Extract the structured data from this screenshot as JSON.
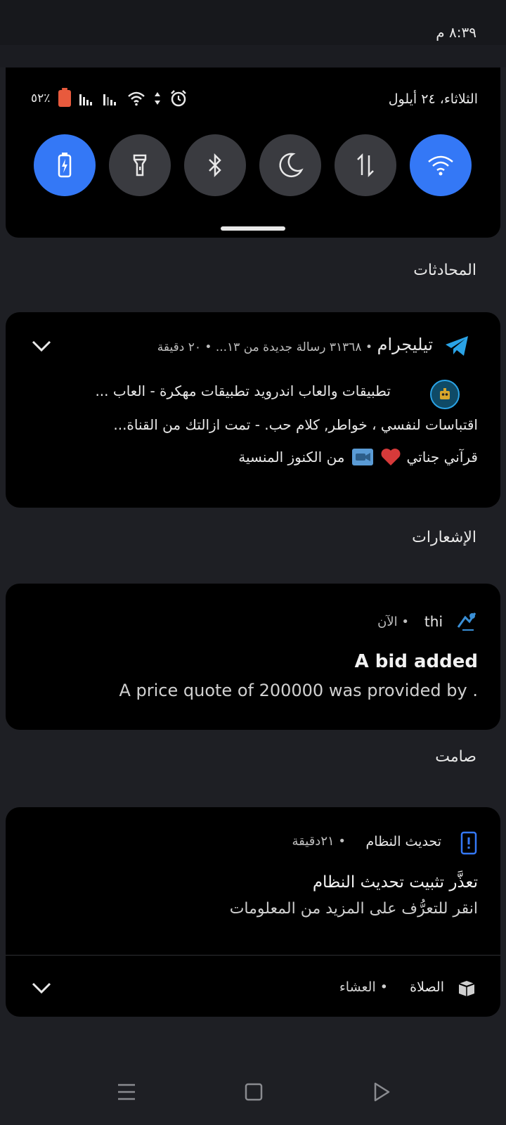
{
  "status_bar": {
    "time": "٨:٣٩ م"
  },
  "quick_settings": {
    "date": "الثلاثاء، ٢٤ أيلول",
    "battery_percent": "٥٢٪",
    "tiles": [
      {
        "icon": "wifi-icon",
        "active": true
      },
      {
        "icon": "data-transfer-icon",
        "active": false
      },
      {
        "icon": "moon-icon",
        "active": false
      },
      {
        "icon": "bluetooth-icon",
        "active": false
      },
      {
        "icon": "flashlight-icon",
        "active": false
      },
      {
        "icon": "battery-saver-icon",
        "active": true
      }
    ],
    "active_color": "#3478f6"
  },
  "sections": {
    "conversations": "المحادثات",
    "notifications": "الإشعارات",
    "silent": "صامت"
  },
  "telegram": {
    "app_name": "تيليجرام",
    "summary": "• ٣١٣٦٨ رسالة جديدة من ١٣... • ٢٠ دقيقة",
    "line1": "تطبيقات والعاب اندرويد  تطبيقات مهكرة - العاب ...",
    "line2": "اقتباسات لنفسي ، خواطر, كلام حب. -     تمت ازالتك من القناة...",
    "line3_start": "قرآني جناتي",
    "line3_end": "من الكنوز المنسية"
  },
  "bid_notification": {
    "app": "thi",
    "time": "• الآن",
    "title": "A bid added",
    "body": "A price quote of 200000 was provided by ."
  },
  "system_update": {
    "app": "تحديث النظام",
    "time": "• ٢١دقيقة",
    "title": "تعذَّر تثبيت تحديث النظام",
    "body": "انقر للتعرُّف على المزيد من المعلومات",
    "accent": "#3478f6"
  },
  "prayer": {
    "app": "الصلاة",
    "label": "• العشاء"
  }
}
